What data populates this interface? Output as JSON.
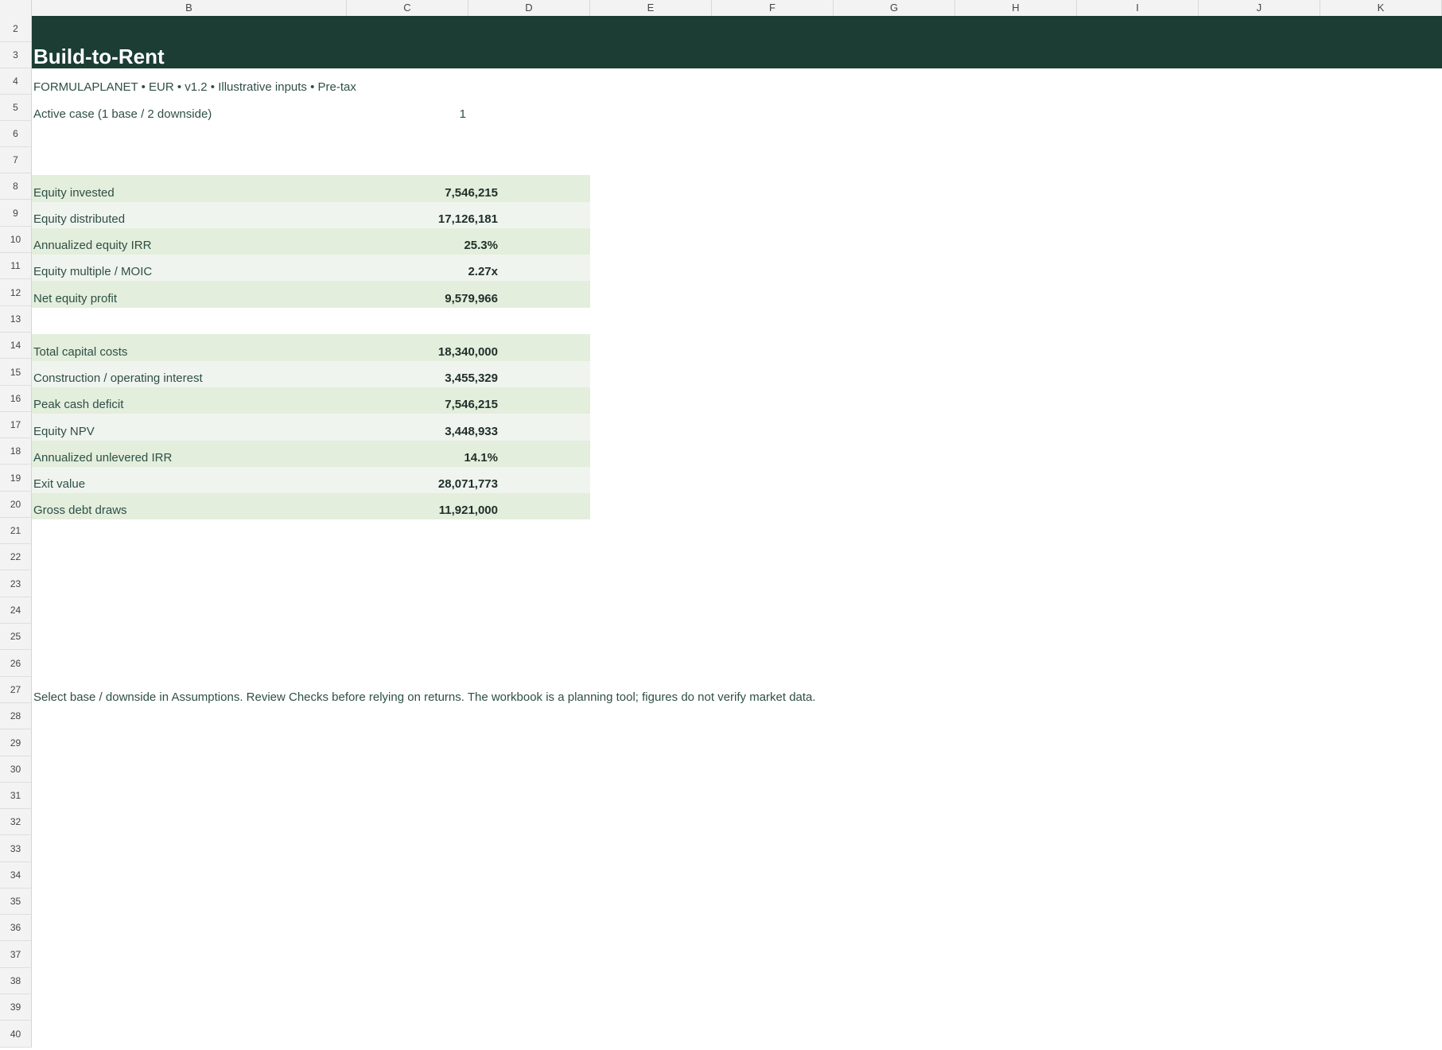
{
  "columns": [
    "B",
    "C",
    "D",
    "E",
    "F",
    "G",
    "H",
    "I",
    "J",
    "K"
  ],
  "rows": [
    "2",
    "3",
    "4",
    "5",
    "6",
    "7",
    "8",
    "9",
    "10",
    "11",
    "12",
    "13",
    "14",
    "15",
    "16",
    "17",
    "18",
    "19",
    "20",
    "21",
    "22",
    "23",
    "24",
    "25",
    "26",
    "27",
    "28",
    "29",
    "30",
    "31",
    "32",
    "33",
    "34",
    "35",
    "36",
    "37",
    "38",
    "39",
    "40"
  ],
  "header": {
    "title": "Build-to-Rent",
    "subtitle": "FORMULAPLANET  •  EUR  •  v1.2  •  Illustrative inputs  •  Pre-tax",
    "case_label": "Active case (1 base / 2 downside)",
    "case_value": "1"
  },
  "kpis_returns": [
    {
      "label": "Equity invested",
      "value": "7,546,215"
    },
    {
      "label": "Equity distributed",
      "value": "17,126,181"
    },
    {
      "label": "Annualized equity IRR",
      "value": "25.3%"
    },
    {
      "label": "Equity multiple / MOIC",
      "value": "2.27x"
    },
    {
      "label": "Net equity profit",
      "value": "9,579,966"
    }
  ],
  "kpis_costs": [
    {
      "label": "Total capital costs",
      "value": "18,340,000"
    },
    {
      "label": "Construction / operating interest",
      "value": "3,455,329"
    },
    {
      "label": "Peak cash deficit",
      "value": "7,546,215"
    },
    {
      "label": "Equity NPV",
      "value": "3,448,933"
    },
    {
      "label": "Annualized unlevered IRR",
      "value": "14.1%"
    },
    {
      "label": "Exit value",
      "value": "28,071,773"
    },
    {
      "label": "Gross debt draws",
      "value": "11,921,000"
    }
  ],
  "note": "Select base / downside in Assumptions. Review Checks before relying on returns. The workbook is a planning tool; figures do not verify market data.",
  "colors": {
    "band": "#1b3d33",
    "row_a": "#e3eedc",
    "row_b": "#f0f4ee",
    "text": "#2f4f47"
  }
}
